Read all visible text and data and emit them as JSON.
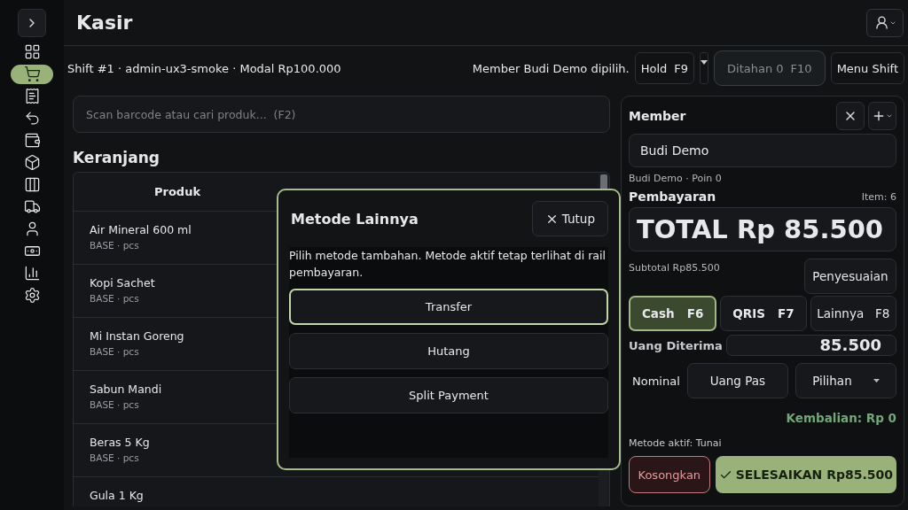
{
  "header": {
    "title": "Kasir"
  },
  "sidebar": {
    "items": [
      {
        "kind": "grid",
        "selected": false
      },
      {
        "kind": "cart",
        "selected": true
      },
      {
        "kind": "receipt",
        "selected": false
      },
      {
        "kind": "undo",
        "selected": false
      },
      {
        "kind": "wallet",
        "selected": false
      },
      {
        "kind": "box",
        "selected": false
      },
      {
        "kind": "table",
        "selected": false
      },
      {
        "kind": "truck",
        "selected": false
      },
      {
        "kind": "user",
        "selected": false
      },
      {
        "kind": "cash",
        "selected": false
      },
      {
        "kind": "chart",
        "selected": false
      },
      {
        "kind": "settings",
        "selected": false
      }
    ]
  },
  "shift_bar": {
    "info": "Shift #1 · admin-ux3-smoke · Modal Rp100.000",
    "notice": "Member Budi Demo dipilih.",
    "hold": {
      "label": "Hold",
      "key": "F9"
    },
    "held": {
      "label": "Ditahan 0",
      "key": "F10",
      "disabled": true
    },
    "menu": "Menu Shift"
  },
  "search": {
    "placeholder": "Scan barcode atau cari produk...  (F2)"
  },
  "cart": {
    "title": "Keranjang",
    "columns": [
      "Produk"
    ],
    "rows": [
      {
        "name": "Air Mineral 600 ml",
        "unit": "BASE · pcs"
      },
      {
        "name": "Kopi Sachet",
        "unit": "BASE · pcs"
      },
      {
        "name": "Mi Instan Goreng",
        "unit": "BASE · pcs"
      },
      {
        "name": "Sabun Mandi",
        "unit": "BASE · pcs"
      },
      {
        "name": "Beras 5 Kg",
        "unit": "BASE · pcs"
      },
      {
        "name": "Gula 1 Kg"
      }
    ]
  },
  "member": {
    "title": "Member",
    "value": "Budi Demo",
    "info": "Budi Demo · Poin 0"
  },
  "payment": {
    "title": "Pembayaran",
    "item_count": "Item: 6",
    "total": "TOTAL Rp 85.500",
    "subtotal": "Subtotal Rp85.500",
    "adjust": "Penyesuaian",
    "methods": [
      {
        "label": "Cash",
        "key": "F6",
        "selected": true
      },
      {
        "label": "QRIS",
        "key": "F7",
        "selected": false
      },
      {
        "label": "Lainnya",
        "key": "F8",
        "selected": false
      }
    ],
    "received_label": "Uang Diterima",
    "received": "85.500",
    "nominal_label": "Nominal",
    "exact": "Uang Pas",
    "options": "Pilihan",
    "change": "Kembalian: Rp 0",
    "active_method": "Metode aktif: Tunai",
    "clear": "Kosongkan",
    "finish": "SELESAIKAN Rp85.500"
  },
  "dialog": {
    "title": "Metode Lainnya",
    "close": "Tutup",
    "text": "Pilih metode tambahan. Metode aktif tetap terlihat di rail pembayaran.",
    "options": [
      {
        "label": "Transfer",
        "selected": true
      },
      {
        "label": "Hutang",
        "selected": false
      },
      {
        "label": "Split Payment",
        "selected": false
      }
    ]
  }
}
